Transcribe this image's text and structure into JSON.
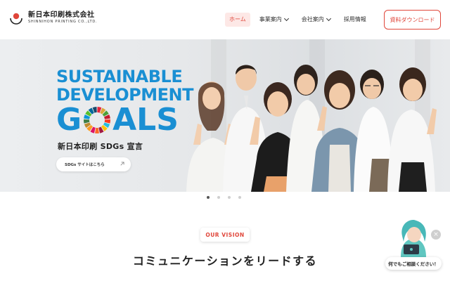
{
  "brand": {
    "name_jp": "新日本印刷株式会社",
    "name_en": "SHINNIHON PRINTING CO.,LTD.",
    "accent_color": "#e0463a"
  },
  "nav": {
    "items": [
      {
        "label": "ホーム",
        "active": true,
        "dropdown": false
      },
      {
        "label": "事業案内",
        "active": false,
        "dropdown": true
      },
      {
        "label": "会社案内",
        "active": false,
        "dropdown": true
      },
      {
        "label": "採用情報",
        "active": false,
        "dropdown": false
      }
    ],
    "download_label": "資料ダウンロード"
  },
  "hero": {
    "sdg_line1": "SUSTAINABLE",
    "sdg_line2": "DEVELOPMENT",
    "sdg_line3_a": "G",
    "sdg_line3_b": "ALS",
    "sdg_color": "#1a8fd3",
    "declaration": "新日本印刷 SDGs 宣言",
    "link_label": "SDGs サイトはこちら",
    "slide_count": 4,
    "active_slide": 1
  },
  "vision": {
    "badge": "OUR VISION",
    "title": "コミュニケーションをリードする"
  },
  "chat": {
    "bubble": "何でもご相談ください！",
    "close_icon": "close-icon"
  }
}
